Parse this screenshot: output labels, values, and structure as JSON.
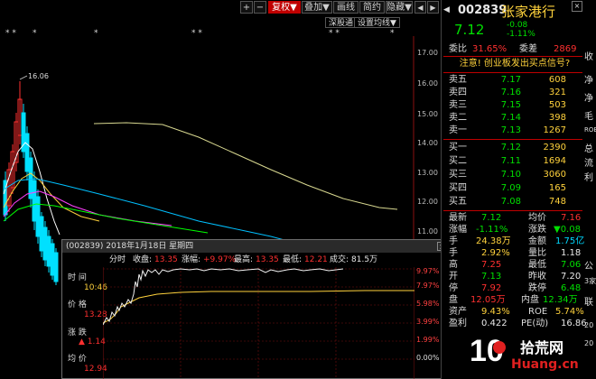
{
  "toolbar": {
    "plus": "+",
    "minus": "−",
    "up": "↑",
    "down": "↓",
    "restore": "复权",
    "overlay": "叠加",
    "draw": "画线",
    "simple": "简约",
    "hide": "隐藏",
    "arrow_left": "◀",
    "arrow_right": "▶",
    "close": "×"
  },
  "chart_tabs": [
    "深股通",
    "设置均线"
  ],
  "chart_markers": [
    "* *",
    "*",
    "*",
    "* *",
    "* *",
    "*"
  ],
  "kline_chart": {
    "high_label": "16.06",
    "y_ticks": [
      "17.00",
      "16.00",
      "15.00",
      "14.00",
      "13.00",
      "12.00",
      "11.00"
    ],
    "colors": {
      "up": "#ff3030",
      "down": "#00e0ff",
      "ma5": "#ffffff",
      "ma10": "#ffd23c",
      "ma20": "#ff40ff",
      "ma30": "#00ff00",
      "ma60": "#00c0ff",
      "ma120": "#d8d890"
    }
  },
  "popup": {
    "title": "(002839) 2018年1月18日 星期四",
    "close": "×",
    "header": {
      "time_label": "分时",
      "close_label": "收盘:",
      "close_value": "13.35",
      "change_label": "涨幅:",
      "change_value": "+9.97%",
      "high_label": "最高:",
      "high_value": "13.35",
      "low_label": "最低:",
      "low_value": "12.21",
      "volume_label": "成交:",
      "volume_value": "81.5万"
    },
    "side": {
      "time": "时 间",
      "time_value": "10:46",
      "price": "价 格",
      "price_value": "13.28",
      "change": "涨 跌",
      "change_value": "1.14",
      "avg": "均 价",
      "avg_value": "12.94"
    },
    "pct_ticks": [
      "9.97%",
      "7.97%",
      "5.98%",
      "3.99%",
      "1.99%",
      "0.00%"
    ]
  },
  "right_panel": {
    "code": "002839",
    "name": "张家港行",
    "price": "7.12",
    "change": "-0.08",
    "change_pct": "-1.11%",
    "webi_label": "委比",
    "webi_value": "31.65%",
    "weicha_label": "委差",
    "weicha_value": "2869",
    "notice": "注意! 创业板发出买点信号?",
    "sells": [
      {
        "label": "卖五",
        "price": "7.17",
        "vol": "608"
      },
      {
        "label": "卖四",
        "price": "7.16",
        "vol": "321"
      },
      {
        "label": "卖三",
        "price": "7.15",
        "vol": "503"
      },
      {
        "label": "卖二",
        "price": "7.14",
        "vol": "398"
      },
      {
        "label": "卖一",
        "price": "7.13",
        "vol": "1267"
      }
    ],
    "buys": [
      {
        "label": "买一",
        "price": "7.12",
        "vol": "2390"
      },
      {
        "label": "买二",
        "price": "7.11",
        "vol": "1694"
      },
      {
        "label": "买三",
        "price": "7.10",
        "vol": "3060"
      },
      {
        "label": "买四",
        "price": "7.09",
        "vol": "165"
      },
      {
        "label": "买五",
        "price": "7.08",
        "vol": "748"
      }
    ],
    "stats": [
      {
        "l1": "最新",
        "v1": "7.12",
        "l2": "均价",
        "v2": "7.16"
      },
      {
        "l1": "涨幅",
        "v1": "-1.11%",
        "l2": "涨跌",
        "v2": "▼0.08"
      },
      {
        "l1": "手",
        "v1": "24.38万",
        "l2": "金额",
        "v2": "1.75亿"
      },
      {
        "l1": "手",
        "v1": "2.92%",
        "l2": "量比",
        "v2": "1.18"
      },
      {
        "l1": "高",
        "v1": "7.25",
        "l2": "最低",
        "v2": "7.06"
      },
      {
        "l1": "开",
        "v1": "7.13",
        "l2": "昨收",
        "v2": "7.20"
      },
      {
        "l1": "停",
        "v1": "7.92",
        "l2": "跌停",
        "v2": "6.48"
      },
      {
        "l1": "盘",
        "v1": "12.05万",
        "l2": "内盘",
        "v2": "12.34万"
      },
      {
        "l1": "资产",
        "v1": "9.43%",
        "l2": "ROE",
        "v2": "5.74%"
      },
      {
        "l1": "盈利",
        "v1": "0.422",
        "l2": "PE(动)",
        "v2": "16.86"
      }
    ],
    "edge_labels": [
      "收",
      "净",
      "净",
      "毛",
      "ROE",
      "总",
      "流",
      "利",
      "公",
      "3家",
      "联",
      "20",
      "20"
    ]
  },
  "watermark": {
    "logo": "10",
    "text1": "拾荒网",
    "text2": "Huang.cn"
  }
}
